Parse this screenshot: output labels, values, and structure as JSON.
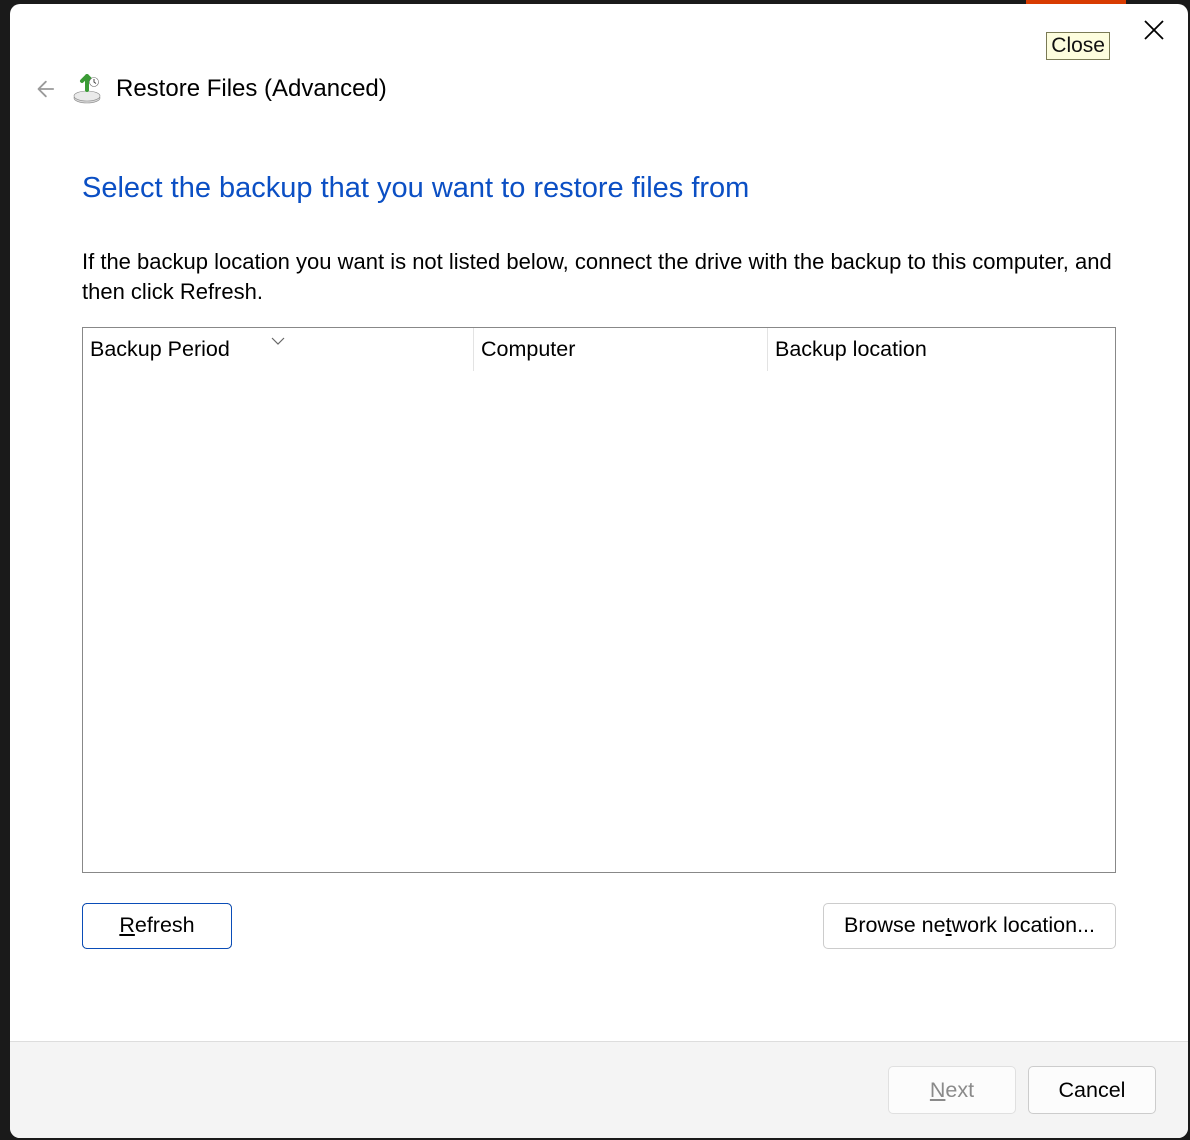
{
  "titlebar": {
    "title": "Restore Files (Advanced)",
    "close_tooltip": "Close"
  },
  "main": {
    "heading": "Select the backup that you want to restore files from",
    "description": "If the backup location you want is not listed below, connect the drive with the backup to this computer, and then click Refresh.",
    "columns": {
      "period": "Backup Period",
      "computer": "Computer",
      "location": "Backup location"
    },
    "rows": []
  },
  "buttons": {
    "refresh_pre": "",
    "refresh_accel": "R",
    "refresh_post": "efresh",
    "browse_pre": "Browse ne",
    "browse_accel": "t",
    "browse_post": "work location..."
  },
  "footer": {
    "next_accel": "N",
    "next_post": "ext",
    "cancel": "Cancel"
  }
}
